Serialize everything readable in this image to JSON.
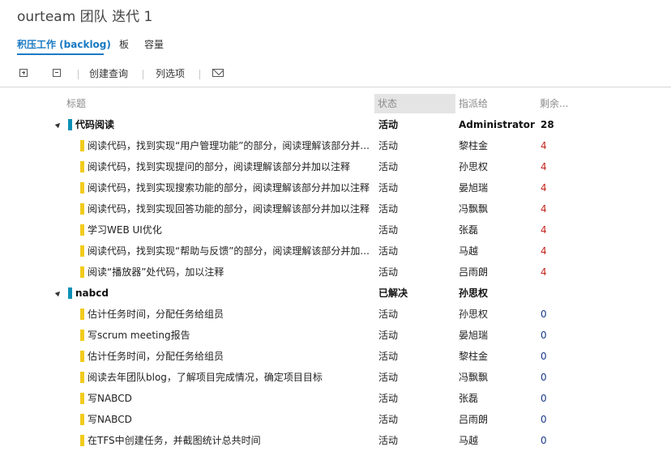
{
  "page": {
    "title": "ourteam 团队 迭代 1"
  },
  "tabs": [
    {
      "label": "积压工作 (backlog)",
      "active": true
    },
    {
      "label": "板",
      "active": false
    },
    {
      "label": "容量",
      "active": false
    }
  ],
  "toolbar": {
    "expand_icon": "expand-all-icon",
    "collapse_icon": "collapse-all-icon",
    "create_query_label": "创建查询",
    "column_options_label": "列选项",
    "email_icon": "mail-icon"
  },
  "columns": {
    "title": "标题",
    "state": "状态",
    "assigned_to": "指派给",
    "remaining": "剩余..."
  },
  "colors": {
    "accent": "#1b7ac3",
    "group_bar": "#0e90b6",
    "task_bar": "#f2cb1d",
    "remaining_nonzero": "#c3261c",
    "remaining_zero": "#1b3a8a"
  },
  "groups": [
    {
      "title": "代码阅读",
      "state": "活动",
      "assigned_to": "Administrator",
      "remaining": "28",
      "tasks": [
        {
          "title": "阅读代码，找到实现“用户管理功能”的部分，阅读理解该部分并...",
          "state": "活动",
          "assigned_to": "黎柱金",
          "remaining": "4"
        },
        {
          "title": "阅读代码，找到实现提问的部分，阅读理解该部分并加以注释",
          "state": "活动",
          "assigned_to": "孙思权",
          "remaining": "4"
        },
        {
          "title": "阅读代码，找到实现搜索功能的部分，阅读理解该部分并加以注释",
          "state": "活动",
          "assigned_to": "晏旭瑞",
          "remaining": "4"
        },
        {
          "title": "阅读代码，找到实现回答功能的部分，阅读理解该部分并加以注释",
          "state": "活动",
          "assigned_to": "冯飘飘",
          "remaining": "4"
        },
        {
          "title": "学习WEB UI优化",
          "state": "活动",
          "assigned_to": "张磊",
          "remaining": "4"
        },
        {
          "title": "阅读代码，找到实现“帮助与反馈”的部分，阅读理解该部分并加...",
          "state": "活动",
          "assigned_to": "马越",
          "remaining": "4"
        },
        {
          "title": "阅读“播放器”处代码，加以注释",
          "state": "活动",
          "assigned_to": "吕雨朗",
          "remaining": "4"
        }
      ]
    },
    {
      "title": "nabcd",
      "state": "已解决",
      "assigned_to": "孙思权",
      "remaining": "",
      "tasks": [
        {
          "title": "估计任务时间，分配任务给组员",
          "state": "活动",
          "assigned_to": "孙思权",
          "remaining": "0"
        },
        {
          "title": "写scrum meeting报告",
          "state": "活动",
          "assigned_to": "晏旭瑞",
          "remaining": "0"
        },
        {
          "title": "估计任务时间，分配任务给组员",
          "state": "活动",
          "assigned_to": "黎柱金",
          "remaining": "0"
        },
        {
          "title": "阅读去年团队blog，了解项目完成情况，确定项目目标",
          "state": "活动",
          "assigned_to": "冯飘飘",
          "remaining": "0"
        },
        {
          "title": "写NABCD",
          "state": "活动",
          "assigned_to": "张磊",
          "remaining": "0"
        },
        {
          "title": "写NABCD",
          "state": "活动",
          "assigned_to": "吕雨朗",
          "remaining": "0"
        },
        {
          "title": "在TFS中创建任务，并截图统计总共时间",
          "state": "活动",
          "assigned_to": "马越",
          "remaining": "0"
        }
      ]
    }
  ]
}
